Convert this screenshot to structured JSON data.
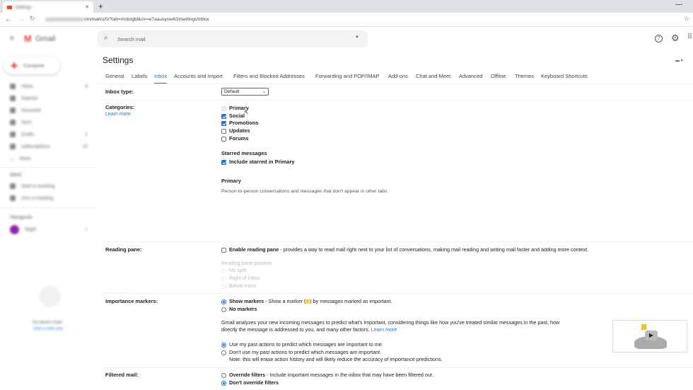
{
  "browser": {
    "tab_title": "Settings - ",
    "url": "om/mail/u/0/?tab=rm&ogbl&zx=w7aauoyxw4l3#settings/inbox",
    "new_tab": "+"
  },
  "header": {
    "app_name": "Gmail",
    "search_placeholder": "Search mail"
  },
  "sidebar": {
    "compose": "Compose",
    "items": [
      {
        "label": "Inbox",
        "count": "4"
      },
      {
        "label": "Starred",
        "count": ""
      },
      {
        "label": "Snoozed",
        "count": ""
      },
      {
        "label": "Sent",
        "count": ""
      },
      {
        "label": "Drafts",
        "count": "1"
      },
      {
        "label": "subscriptions",
        "count": "12"
      },
      {
        "label": "More",
        "count": ""
      }
    ],
    "meet_heading": "Meet",
    "meet_items": [
      "Start a meeting",
      "Join a meeting"
    ],
    "hangouts_heading": "Hangouts",
    "hangouts_user": "Nigel",
    "no_chats": "No recent chats",
    "start_new": "Start a new one"
  },
  "settings": {
    "title": "Settings",
    "tabs": [
      "General",
      "Labels",
      "Inbox",
      "Accounts and Import",
      "Filters and Blocked Addresses",
      "Forwarding and POP/IMAP",
      "Add-ons",
      "Chat and Meet",
      "Advanced",
      "Offline",
      "Themes",
      "Keyboard Shortcuts"
    ],
    "active_tab": "Inbox",
    "inbox_type": {
      "label": "Inbox type:",
      "value": "Default"
    },
    "categories": {
      "label": "Categories:",
      "learn_more": "Learn more",
      "options": [
        {
          "label": "Primary",
          "checked": true,
          "disabled": true
        },
        {
          "label": "Social",
          "checked": true
        },
        {
          "label": "Promotions",
          "checked": true
        },
        {
          "label": "Updates",
          "checked": false
        },
        {
          "label": "Forums",
          "checked": false
        }
      ],
      "starred_heading": "Starred messages",
      "starred_option": "Include starred in Primary",
      "desc_heading": "Primary",
      "desc_text": "Person-to-person conversations and messages that don't appear in other tabs."
    },
    "reading_pane": {
      "label": "Reading pane:",
      "enable": "Enable reading pane",
      "enable_desc": " - provides a way to read mail right next to your list of conversations, making mail reading and writing mail faster and adding more context.",
      "position_heading": "Reading pane position",
      "positions": [
        "No split",
        "Right of inbox",
        "Below inbox"
      ]
    },
    "importance": {
      "label": "Importance markers:",
      "show": "Show markers",
      "show_desc_a": " - Show a marker (",
      "show_desc_b": ") by messages marked as important.",
      "no": "No markers",
      "analysis_1": "Gmail analyzes your new incoming messages to predict what's important, considering things like how you've treated similar messages in the past, how",
      "analysis_2": "directly the message is addressed to you, and many other factors. ",
      "learn_more": "Learn more",
      "use_past": "Use my past actions to predict which messages are important to me.",
      "dont_use_past": "Don't use my past actions to predict which messages are important.",
      "note": "Note: this will erase action history and will likely reduce the accuracy of importance predictions."
    },
    "filtered": {
      "label": "Filtered mail:",
      "override": "Override filters",
      "override_desc": " - Include important messages in the inbox that may have been filtered out.",
      "dont_override": "Don't override filters"
    }
  },
  "colors": {
    "accent": "#1a73e8",
    "gmail_red": "#ea4335"
  }
}
